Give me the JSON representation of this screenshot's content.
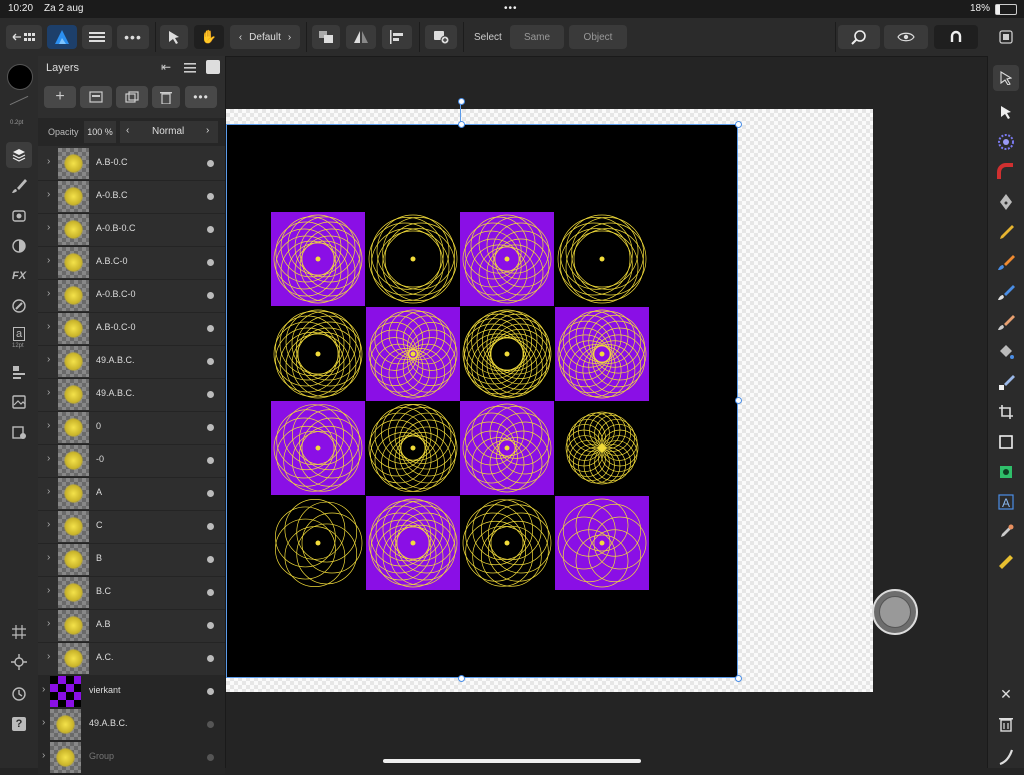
{
  "status": {
    "time": "10:20",
    "date": "Za 2 aug",
    "battery": "18%"
  },
  "toolbar": {
    "style_selector": "Default",
    "select_label": "Select",
    "same_button": "Same",
    "object_button": "Object"
  },
  "layers_panel": {
    "title": "Layers",
    "opacity_label": "Opacity",
    "opacity_value": "100 %",
    "blend_mode": "Normal",
    "layers": [
      {
        "name": "A.B-0.C",
        "thumb": "yellow-circle"
      },
      {
        "name": "A-0.B.C",
        "thumb": "yellow-circle"
      },
      {
        "name": "A-0.B-0.C",
        "thumb": "yellow-circle"
      },
      {
        "name": "A.B.C-0",
        "thumb": "yellow-circle"
      },
      {
        "name": "A-0.B.C-0",
        "thumb": "yellow-circle"
      },
      {
        "name": "A.B-0.C-0",
        "thumb": "yellow-circle"
      },
      {
        "name": "49.A.B.C.",
        "thumb": "yellow-circle"
      },
      {
        "name": "49.A.B.C.",
        "thumb": "yellow-circle"
      },
      {
        "name": "0",
        "thumb": "yellow-circle"
      },
      {
        "name": "-0",
        "thumb": "yellow-circle"
      },
      {
        "name": "A",
        "thumb": "yellow-circle"
      },
      {
        "name": "C",
        "thumb": "yellow-circle"
      },
      {
        "name": "B",
        "thumb": "yellow-circle"
      },
      {
        "name": "B.C",
        "thumb": "yellow-circle"
      },
      {
        "name": "A.B",
        "thumb": "yellow-circle"
      },
      {
        "name": "A.C.",
        "thumb": "yellow-circle"
      },
      {
        "name": "vierkant",
        "thumb": "purple-checker"
      },
      {
        "name": "49.A.B.C.",
        "thumb": "yellow-circle"
      },
      {
        "name": "Group",
        "thumb": "checker"
      }
    ]
  },
  "left_tools": {
    "stroke_width": "0.2pt",
    "text_size": "12pt"
  },
  "colors": {
    "purple": "#8a0fe6",
    "yellow": "#f2dc3a",
    "accent": "#4a8ee6"
  }
}
